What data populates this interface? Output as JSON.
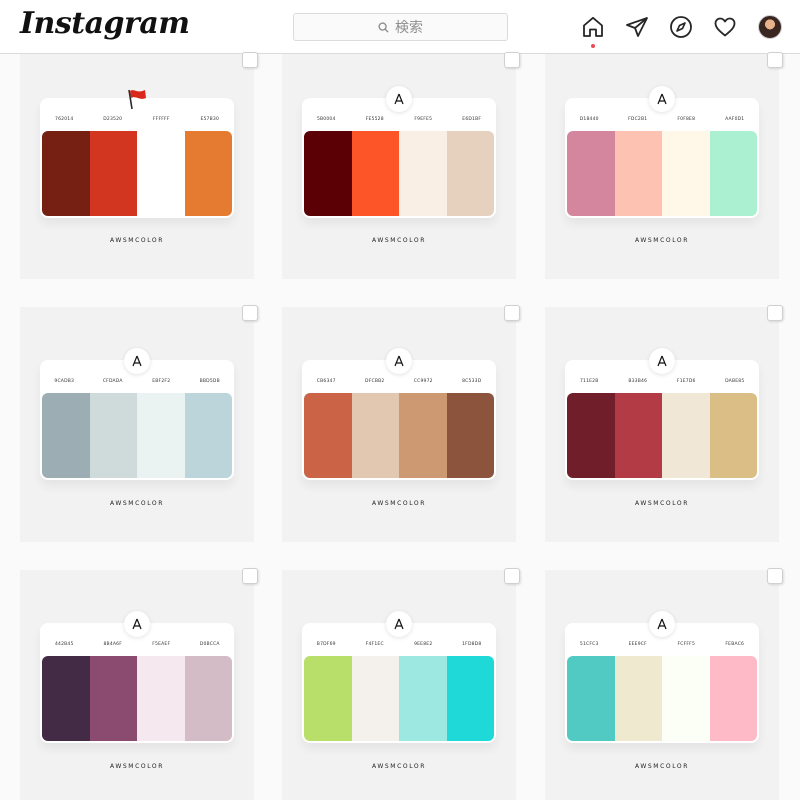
{
  "app": {
    "name": "Instagram"
  },
  "search": {
    "placeholder": "検索"
  },
  "nav": {
    "icons": [
      "home-icon",
      "direct-icon",
      "explore-icon",
      "activity-icon",
      "profile-avatar"
    ]
  },
  "tiles": [
    {
      "brand": "AWSMCOLOR",
      "logo_icon": "red-flag-icon",
      "hex": [
        "762014",
        "D23520",
        "FFFFFF",
        "E57B30"
      ],
      "colors": [
        "#762014",
        "#D23520",
        "#FFFFFF",
        "#E57B30"
      ]
    },
    {
      "brand": "AWSMCOLOR",
      "logo_icon": "awsm-logo-icon",
      "hex": [
        "5B0004",
        "FE5528",
        "F9EFE5",
        "E6D1BF"
      ],
      "colors": [
        "#5B0004",
        "#FE5528",
        "#F9EFE5",
        "#E6D1BF"
      ]
    },
    {
      "brand": "AWSMCOLOR",
      "logo_icon": "awsm-logo-icon",
      "hex": [
        "D18440",
        "FDC2B1",
        "F0F8E8",
        "AAF0D1"
      ],
      "colors": [
        "#D4869E",
        "#FDC2B1",
        "#FFF8E8",
        "#AAF0D1"
      ]
    },
    {
      "brand": "AWSMCOLOR",
      "logo_icon": "awsm-logo-icon",
      "hex": [
        "9CADB3",
        "CFDADA",
        "EBF2F2",
        "BBD5DB"
      ],
      "colors": [
        "#9CADB3",
        "#CFDADA",
        "#EBF2F2",
        "#BBD5DB"
      ]
    },
    {
      "brand": "AWSMCOLOR",
      "logo_icon": "awsm-logo-icon",
      "hex": [
        "CB6347",
        "DFCBB2",
        "CC9972",
        "8C533D"
      ],
      "colors": [
        "#CB6347",
        "#E2C8B0",
        "#CC9972",
        "#8C533D"
      ]
    },
    {
      "brand": "AWSMCOLOR",
      "logo_icon": "awsm-logo-icon",
      "hex": [
        "711E2B",
        "B33B46",
        "F1E7D6",
        "DABE85"
      ],
      "colors": [
        "#711E2B",
        "#B33B46",
        "#F1E7D6",
        "#DABE85"
      ]
    },
    {
      "brand": "AWSMCOLOR",
      "logo_icon": "awsm-logo-icon",
      "hex": [
        "442B45",
        "8B4A6F",
        "F5EAEF",
        "D0BCCA"
      ],
      "colors": [
        "#442B45",
        "#8B4A6F",
        "#F5E8EF",
        "#D3BCC6"
      ]
    },
    {
      "brand": "AWSMCOLOR",
      "logo_icon": "awsm-logo-icon",
      "hex": [
        "B7DF69",
        "F4F1EC",
        "9EE8E2",
        "1FD8D8"
      ],
      "colors": [
        "#B7DF69",
        "#F4F1EC",
        "#9EE8E2",
        "#1FD8D8"
      ]
    },
    {
      "brand": "AWSMCOLOR",
      "logo_icon": "awsm-logo-icon",
      "hex": [
        "51CFC3",
        "EEE9CF",
        "FCFFF5",
        "FEBAC6"
      ],
      "colors": [
        "#51CAC3",
        "#EEE9CF",
        "#FCFFF5",
        "#FEBAC6"
      ]
    }
  ]
}
